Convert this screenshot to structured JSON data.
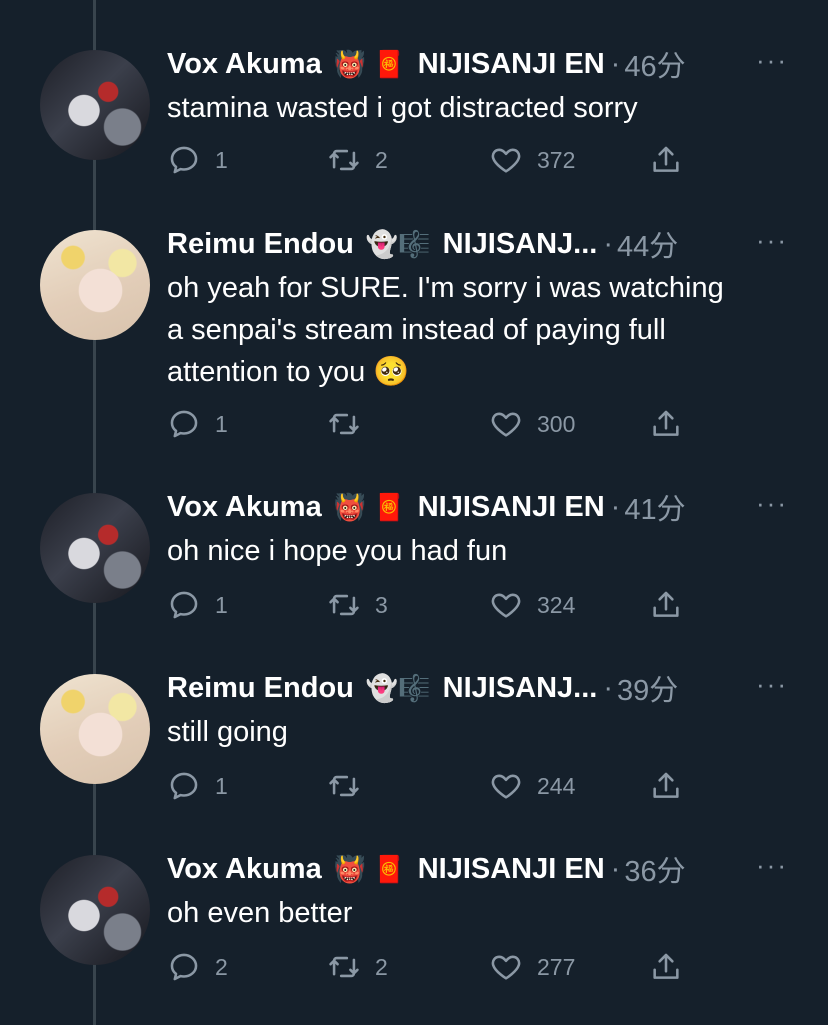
{
  "tweets": [
    {
      "author": "Vox Akuma",
      "badge": "👹 🧧",
      "affiliation": "NIJISANJI EN",
      "time": "46分",
      "more": "···",
      "text_lines": [
        "stamina wasted i got distracted sorry"
      ],
      "replies": "1",
      "retweets": "2",
      "likes": "372",
      "avatar": "vox"
    },
    {
      "author": "Reimu Endou",
      "badge": "👻🎼",
      "affiliation": "NIJISANJ...",
      "time": "44分",
      "more": "···",
      "text_lines": [
        "oh yeah for SURE. I'm sorry i was watching",
        "a senpai's stream instead of paying full",
        "attention to you 🥺"
      ],
      "replies": "1",
      "retweets": "",
      "likes": "300",
      "avatar": "reimu"
    },
    {
      "author": "Vox Akuma",
      "badge": "👹 🧧",
      "affiliation": "NIJISANJI EN",
      "time": "41分",
      "more": "···",
      "text_lines": [
        "oh nice i hope you had fun"
      ],
      "replies": "1",
      "retweets": "3",
      "likes": "324",
      "avatar": "vox"
    },
    {
      "author": "Reimu Endou",
      "badge": "👻🎼",
      "affiliation": "NIJISANJ...",
      "time": "39分",
      "more": "···",
      "text_lines": [
        "still going"
      ],
      "replies": "1",
      "retweets": "",
      "likes": "244",
      "avatar": "reimu"
    },
    {
      "author": "Vox Akuma",
      "badge": "👹 🧧",
      "affiliation": "NIJISANJI EN",
      "time": "36分",
      "more": "···",
      "text_lines": [
        "oh even better"
      ],
      "replies": "2",
      "retweets": "2",
      "likes": "277",
      "avatar": "vox"
    }
  ],
  "icons": {
    "reply": "reply-icon",
    "retweet": "retweet-icon",
    "like": "heart-icon",
    "share": "share-icon"
  },
  "colors": {
    "background": "#15202b",
    "secondary_text": "#8b98a5",
    "thread_line": "#38444d"
  }
}
